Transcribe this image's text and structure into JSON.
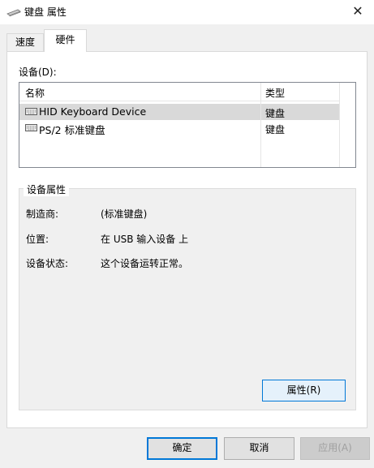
{
  "window": {
    "title": "键盘 属性",
    "close_glyph": "✕"
  },
  "tabs": [
    {
      "label": "速度",
      "active": false
    },
    {
      "label": "硬件",
      "active": true
    }
  ],
  "devices": {
    "label": "设备(D):",
    "columns": {
      "name": "名称",
      "type": "类型"
    },
    "rows": [
      {
        "name": "HID Keyboard Device",
        "type": "键盘",
        "selected": true,
        "icon": "keyboard-icon"
      },
      {
        "name": "PS/2 标准键盘",
        "type": "键盘",
        "selected": false,
        "icon": "keyboard-icon"
      }
    ]
  },
  "properties": {
    "title": "设备属性",
    "manufacturer_label": "制造商:",
    "manufacturer_value": "(标准键盘)",
    "location_label": "位置:",
    "location_value": "在 USB 输入设备 上",
    "status_label": "设备状态:",
    "status_value": "这个设备运转正常。",
    "button_label": "属性(R)"
  },
  "footer": {
    "ok_label": "确定",
    "cancel_label": "取消",
    "apply_label": "应用(A)"
  },
  "colors": {
    "accent": "#0078d7",
    "selection": "#d9d9d9",
    "window_bg": "#f0f0f0"
  }
}
